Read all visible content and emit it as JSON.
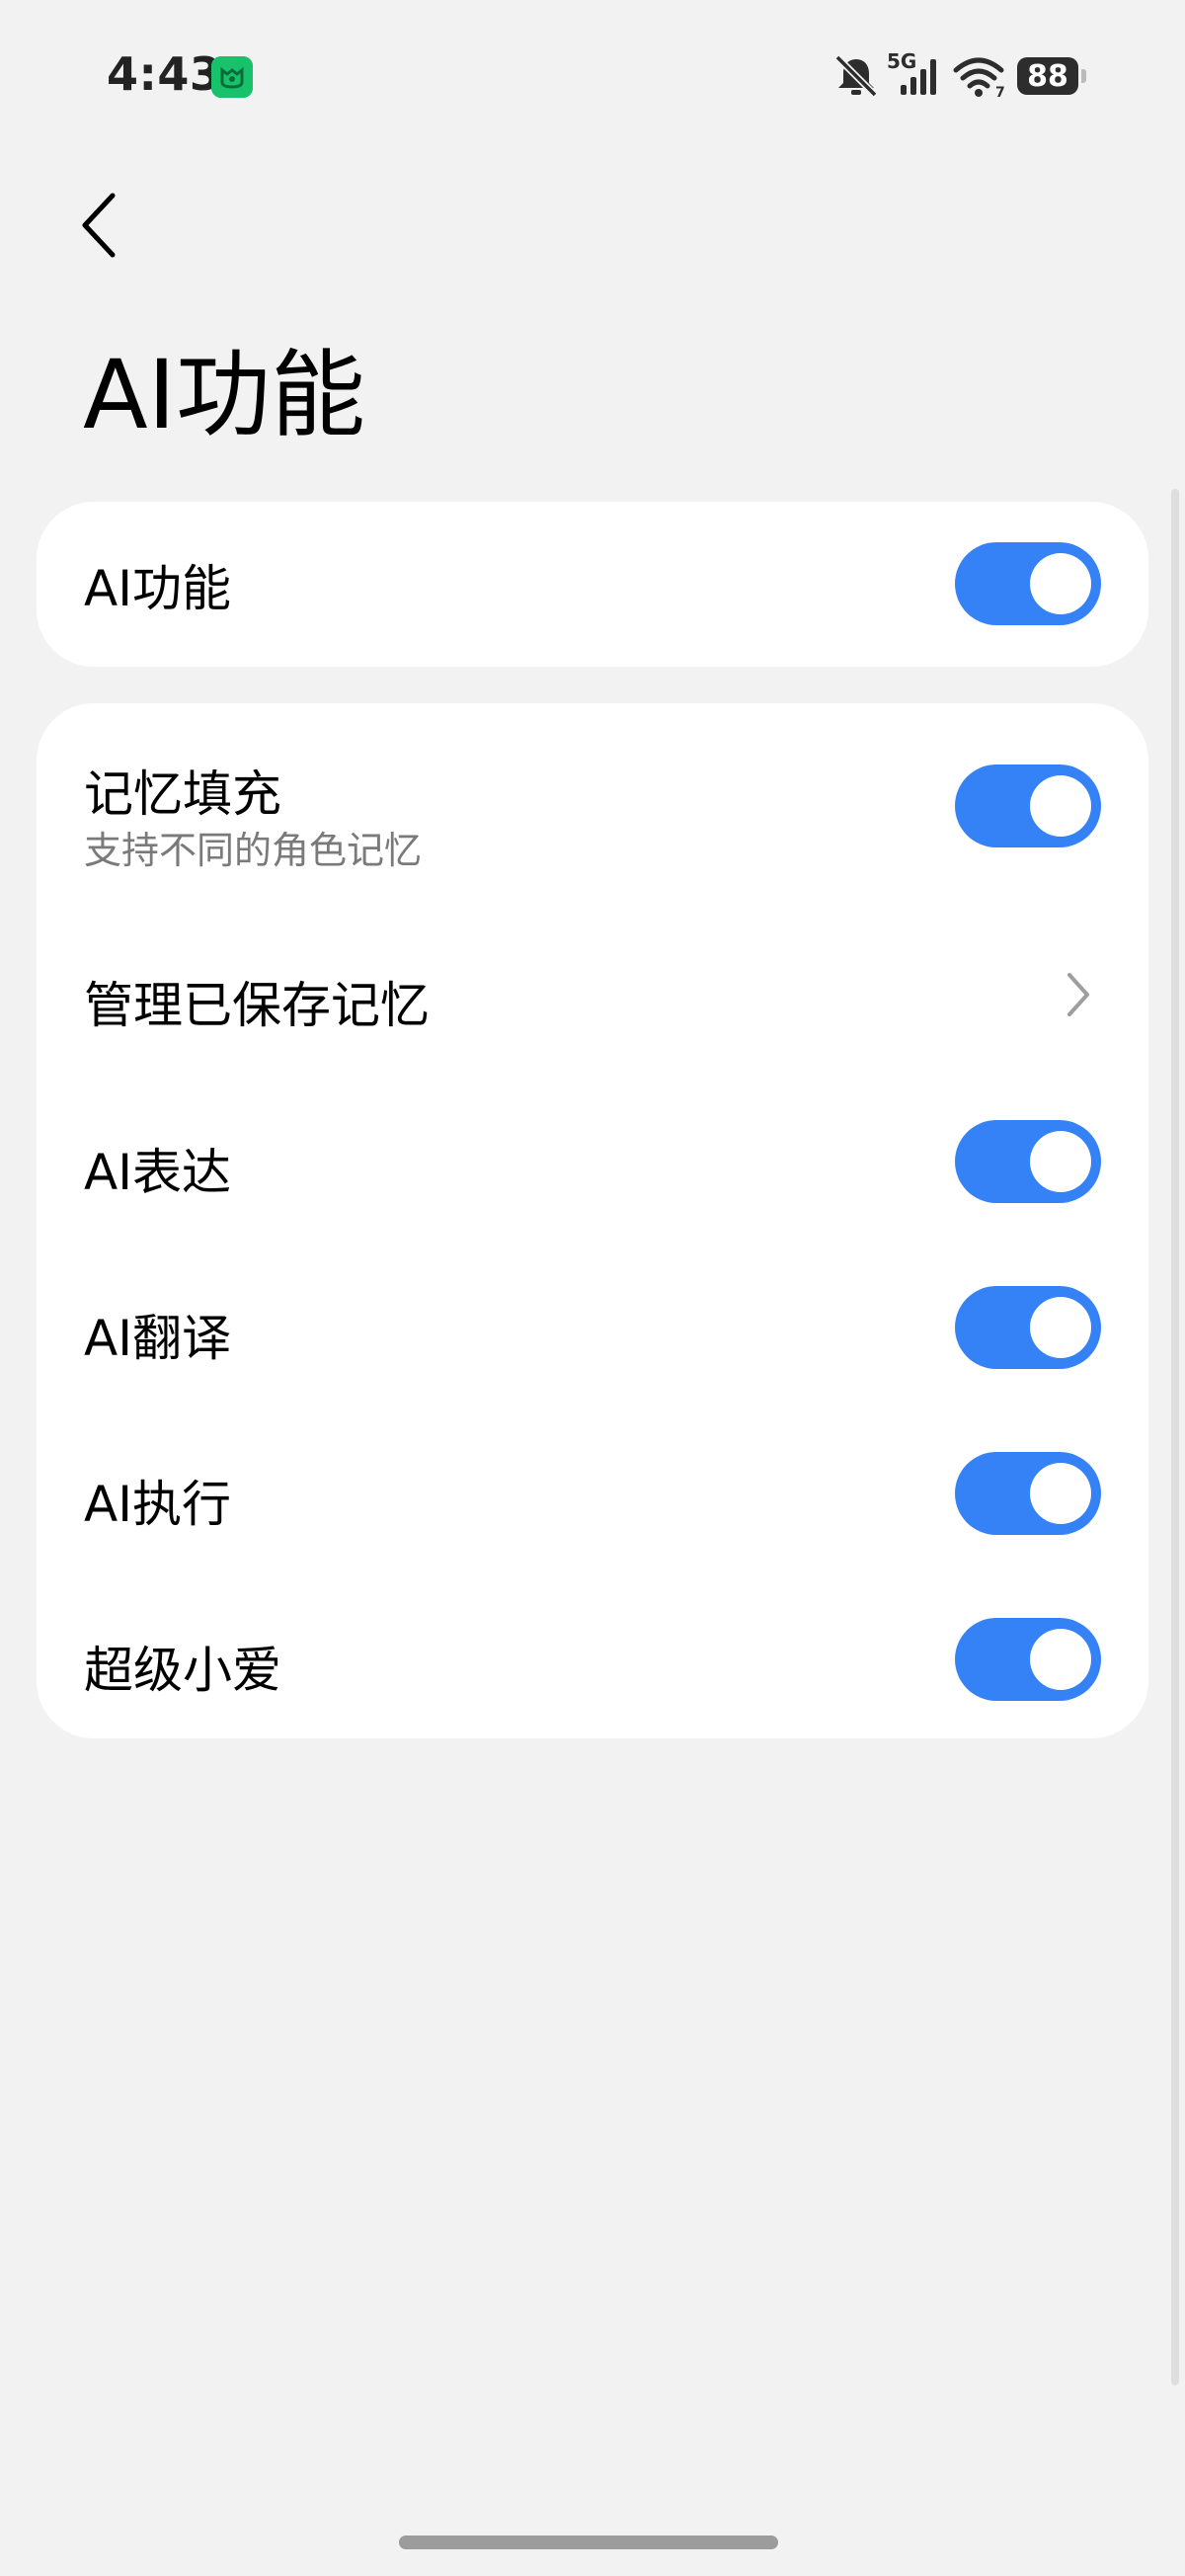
{
  "status_bar": {
    "time": "4:43",
    "network": "5G",
    "battery": "88",
    "app_icon": "mi-home-icon",
    "icons": [
      "silent-bell-icon",
      "signal-icon",
      "wifi-icon",
      "battery-icon"
    ]
  },
  "header": {
    "back_icon": "back-arrow-icon",
    "title": "AI功能"
  },
  "main_card": {
    "label": "AI功能",
    "toggle_on": true
  },
  "settings": {
    "memory_fill": {
      "label": "记忆填充",
      "subtitle": "支持不同的角色记忆",
      "toggle_on": true
    },
    "manage_memory": {
      "label": "管理已保存记忆",
      "icon": "chevron-right-icon"
    },
    "ai_expression": {
      "label": "AI表达",
      "toggle_on": true
    },
    "ai_translate": {
      "label": "AI翻译",
      "toggle_on": true
    },
    "ai_execute": {
      "label": "AI执行",
      "toggle_on": true
    },
    "super_xiaoai": {
      "label": "超级小爱",
      "toggle_on": true
    }
  },
  "colors": {
    "accent": "#3482f6",
    "background": "#f2f2f2",
    "card": "#ffffff",
    "subtitle": "#7a7a7a"
  }
}
